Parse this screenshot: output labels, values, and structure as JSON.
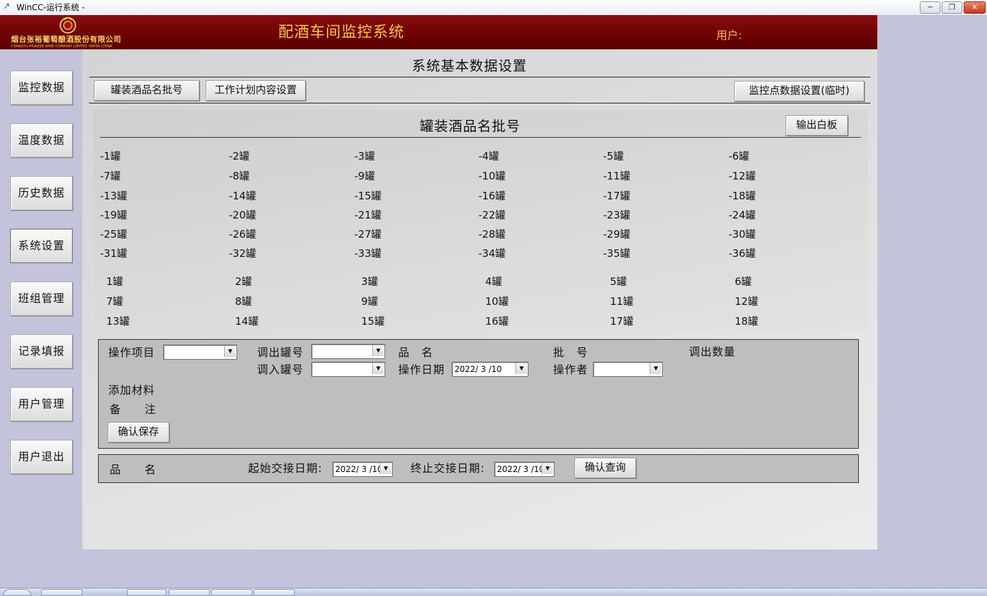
{
  "window": {
    "title": "WinCC-运行系统 -",
    "minimize_label": "─",
    "restore_label": "❐",
    "close_label": "✕"
  },
  "header": {
    "company_name": "烟台张裕葡萄酿酒股份有限公司",
    "company_en": "CHANGYU PIONEER WINE COMPANY LIMITED YANTAI CHINA",
    "app_title": "配酒车间监控系统",
    "user_label": "用户:"
  },
  "nav": {
    "items": [
      {
        "label": "监控数据"
      },
      {
        "label": "温度数据"
      },
      {
        "label": "历史数据"
      },
      {
        "label": "系统设置"
      },
      {
        "label": "班组管理"
      },
      {
        "label": "记录填报"
      },
      {
        "label": "用户管理"
      },
      {
        "label": "用户退出"
      }
    ]
  },
  "main": {
    "title": "系统基本数据设置",
    "tabs": [
      {
        "label": "罐装酒品名批号"
      },
      {
        "label": "工作计划内容设置"
      }
    ],
    "monitor_button": "监控点数据设置(临时)"
  },
  "section": {
    "title": "罐装酒品名批号",
    "export_button": "输出白板"
  },
  "tanks_negative": [
    [
      "-1罐",
      "-2罐",
      "-3罐",
      "-4罐",
      "-5罐",
      "-6罐"
    ],
    [
      "-7罐",
      "-8罐",
      "-9罐",
      "-10罐",
      "-11罐",
      "-12罐"
    ],
    [
      "-13罐",
      "-14罐",
      "-15罐",
      "-16罐",
      "-17罐",
      "-18罐"
    ],
    [
      "-19罐",
      "-20罐",
      "-21罐",
      "-22罐",
      "-23罐",
      "-24罐"
    ],
    [
      "-25罐",
      "-26罐",
      "-27罐",
      "-28罐",
      "-29罐",
      "-30罐"
    ],
    [
      "-31罐",
      "-32罐",
      "-33罐",
      "-34罐",
      "-35罐",
      "-36罐"
    ]
  ],
  "tanks_positive": [
    [
      "1罐",
      "2罐",
      "3罐",
      "4罐",
      "5罐",
      "6罐"
    ],
    [
      "7罐",
      "8罐",
      "9罐",
      "10罐",
      "11罐",
      "12罐"
    ],
    [
      "13罐",
      "14罐",
      "15罐",
      "16罐",
      "17罐",
      "18罐"
    ]
  ],
  "operation": {
    "op_item_label": "操作项目",
    "op_item_value": "",
    "out_tank_label": "调出罐号",
    "out_tank_value": "",
    "in_tank_label": "调入罐号",
    "in_tank_value": "",
    "product_label": "品　名",
    "op_date_label": "操作日期",
    "op_date_value": "2022/ 3 /10",
    "batch_label": "批　号",
    "operator_label": "操作者",
    "operator_value": "",
    "out_qty_label": "调出数量",
    "material_label": "添加材料",
    "remark_label": "备　　注",
    "save_button": "确认保存"
  },
  "query": {
    "product_label": "品　　名",
    "start_label": "起始交接日期:",
    "start_value": "2022/ 3 /10",
    "end_label": "终止交接日期:",
    "end_value": "2022/ 3 /10",
    "query_button": "确认查询"
  },
  "icons": {
    "dropdown": "▼",
    "app": "↗"
  },
  "colors": {
    "banner": "#6c0000",
    "banner_text": "#f5c84a",
    "background": "#c3c3dc"
  }
}
